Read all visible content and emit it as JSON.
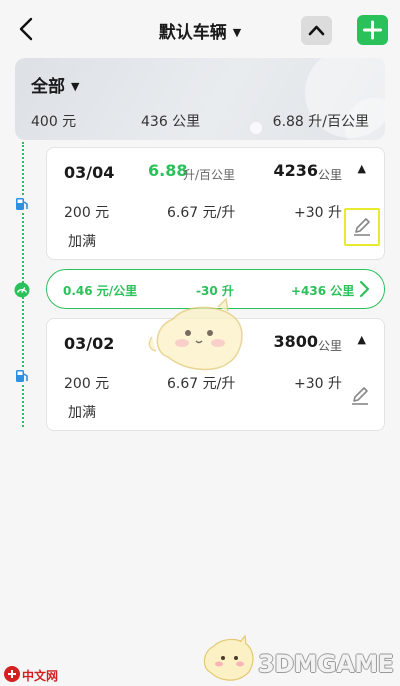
{
  "header": {
    "title": "默认车辆",
    "title_caret": "▼",
    "collapse_icon": "chevron-up-icon",
    "add_icon": "plus-icon",
    "back_icon": "chevron-left-icon"
  },
  "summary": {
    "filter_label": "全部",
    "filter_caret": "▼",
    "total_cost": "400 元",
    "total_distance": "436 公里",
    "avg_consumption": "6.88 升/百公里"
  },
  "records": [
    {
      "date": "03/04",
      "consumption_value": "6.88",
      "consumption_unit": "升/百公里",
      "odometer": "4236",
      "odometer_unit": "公里",
      "caret": "▲",
      "cost": "200 元",
      "unit_price": "6.67 元/升",
      "volume": "+30 升",
      "fill_status": "加满"
    },
    {
      "date": "03/02",
      "consumption_value": "",
      "consumption_unit": "",
      "odometer": "3800",
      "odometer_unit": "公里",
      "caret": "▲",
      "cost": "200 元",
      "unit_price": "6.67 元/升",
      "volume": "+30 升",
      "fill_status": "加满"
    }
  ],
  "segment": {
    "cost_per_km": "0.46 元/公里",
    "volume_diff": "-30 升",
    "distance_diff": "+436 公里"
  },
  "watermarks": {
    "left_text": "中文网",
    "right_text": "3DMGAME"
  },
  "colors": {
    "accent": "#2bc15a",
    "selected_outline": "#e8ea2f"
  }
}
